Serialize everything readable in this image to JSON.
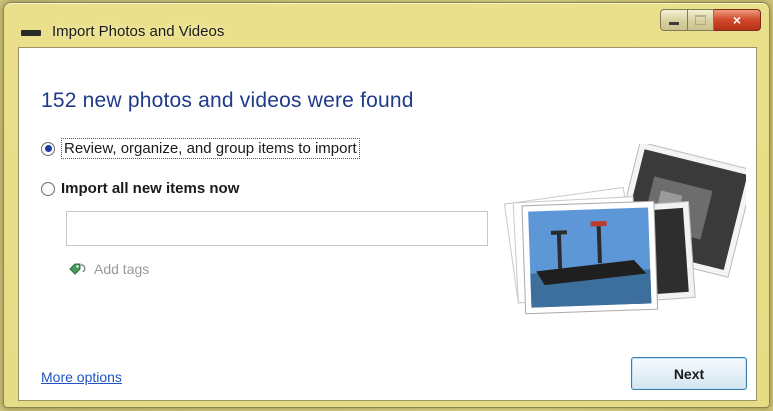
{
  "window": {
    "title": "Import Photos and Videos",
    "controls": {
      "minimize": "minimize",
      "maximize": "maximize",
      "close": "×"
    }
  },
  "main": {
    "heading": "152 new photos and videos were found",
    "options": [
      {
        "label": "Review, organize, and group items to import",
        "selected": true
      },
      {
        "label": "Import all new items now",
        "selected": false
      }
    ],
    "tags_input": {
      "value": "",
      "placeholder": ""
    },
    "add_tags_label": "Add tags"
  },
  "footer": {
    "more_options": "More options",
    "next_button": "Next"
  },
  "colors": {
    "heading": "#1f3a8a",
    "link": "#1f55c0",
    "frame": "#e6dc86",
    "close_button": "#d2482a"
  },
  "icons": [
    "window-icon",
    "minimize-icon",
    "maximize-icon",
    "close-icon",
    "tag-icon",
    "photo-stack-illustration"
  ]
}
